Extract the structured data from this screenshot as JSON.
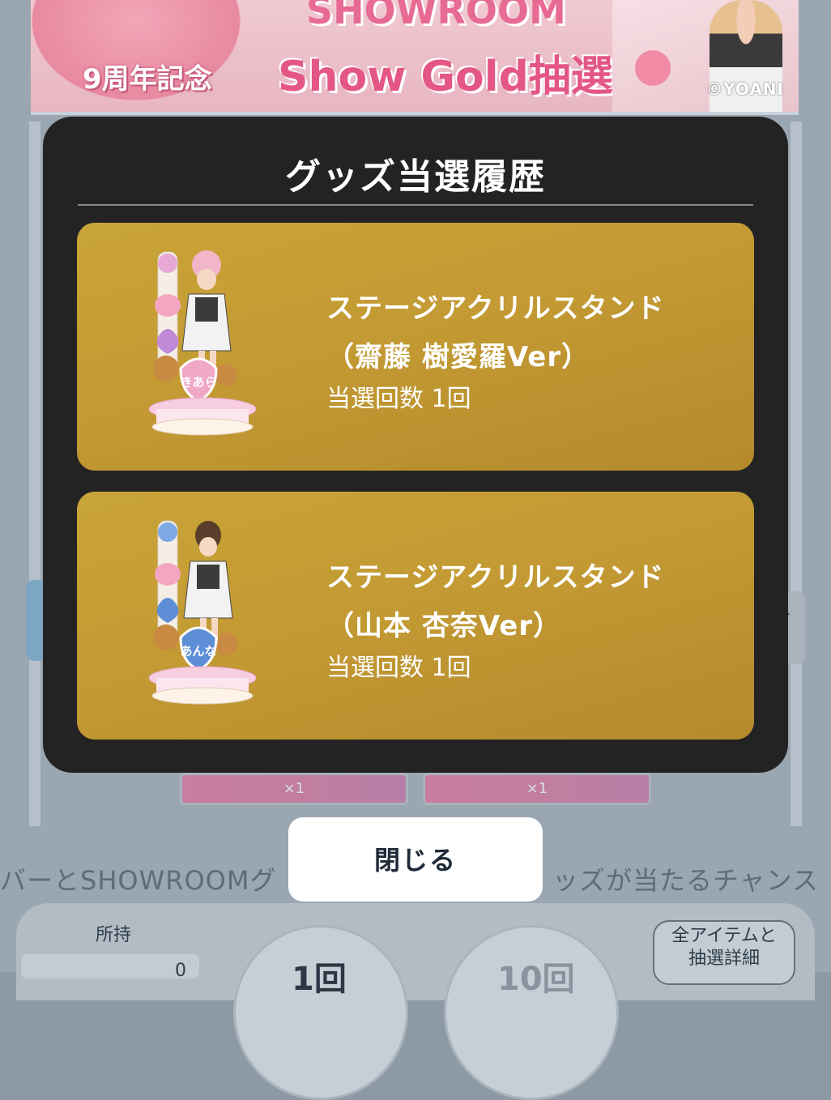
{
  "banner": {
    "anniversary": "9周年記念",
    "title_line1": "SHOWROOM",
    "title_line2": "Show Gold抽選",
    "credit": "©YOANI"
  },
  "background": {
    "qty_labels": [
      "×1",
      "×1"
    ],
    "description_left": "バーとSHOWROOMグ",
    "description_right": "ッズが当たるチャンス",
    "owned_label": "所持",
    "owned_count": "0",
    "draw_buttons": [
      "1回",
      "10回"
    ],
    "detail_button": [
      "全アイテムと",
      "抽選詳細"
    ]
  },
  "modal": {
    "title": "グッズ当選履歴",
    "items": [
      {
        "name_line1": "ステージアクリルスタンド",
        "name_line2": "（齋藤 樹愛羅Ver）",
        "count": "当選回数 1回",
        "nameplate": "きあら",
        "heart_color": "#f1a7c6"
      },
      {
        "name_line1": "ステージアクリルスタンド",
        "name_line2": "（山本 杏奈Ver）",
        "count": "当選回数 1回",
        "nameplate": "あんな",
        "heart_color": "#5e8fd6"
      }
    ],
    "close_label": "閉じる"
  },
  "colors": {
    "card_gold": "#c39a33",
    "modal_bg": "#232323"
  }
}
